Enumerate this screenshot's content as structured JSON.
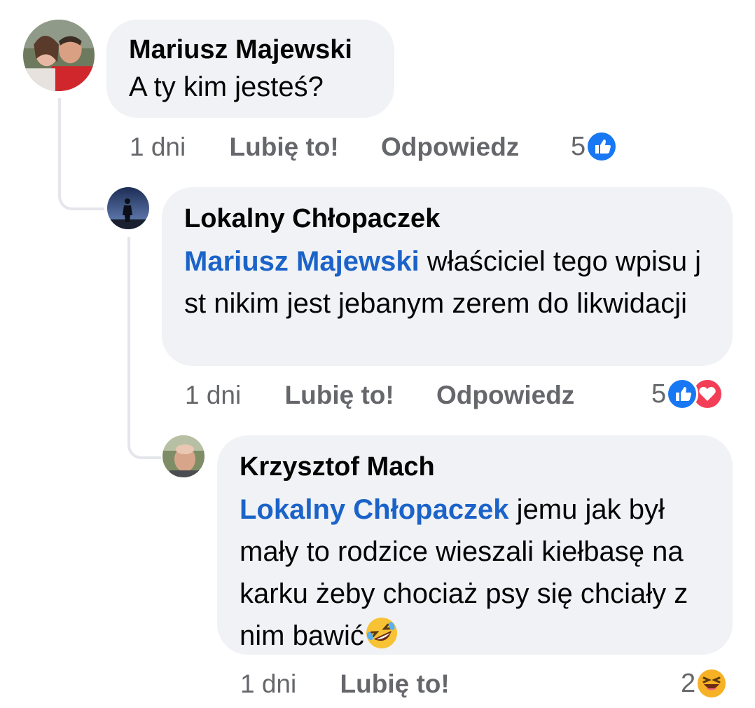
{
  "comments": [
    {
      "author": "Mariusz Majewski",
      "text": "A ty kim jesteś?",
      "time": "1 dni",
      "like_label": "Lubię to!",
      "reply_label": "Odpowiedz",
      "reaction_count": "5",
      "reactions": [
        "like-icon"
      ],
      "avatar": "couple-photo-avatar"
    },
    {
      "author": "Lokalny Chłopaczek",
      "mention": "Mariusz Majewski",
      "text": " właściciel tego wpisu j st nikim jest jebanym zerem do likwidacji",
      "time": "1 dni",
      "like_label": "Lubię to!",
      "reply_label": "Odpowiedz",
      "reaction_count": "5",
      "reactions": [
        "like-icon",
        "love-icon"
      ],
      "avatar": "silhouette-avatar"
    },
    {
      "author": "Krzysztof Mach",
      "mention": "Lokalny Chłopaczek",
      "text": " jemu jak był mały to rodzice  wieszali kiełbasę na karku żeby chociaż psy się chciały z nim bawić",
      "emoji": "rolling-on-floor-laughing-emoji",
      "time": "1 dni",
      "like_label": "Lubię to!",
      "reaction_count": "2",
      "reactions": [
        "haha-icon"
      ],
      "avatar": "man-photo-avatar"
    }
  ],
  "colors": {
    "bubble": "#f0f2f5",
    "mention": "#1b63c9",
    "meta": "#65676b",
    "like": "#1877f2",
    "love": "#f33e58",
    "haha": "#f7b125"
  }
}
